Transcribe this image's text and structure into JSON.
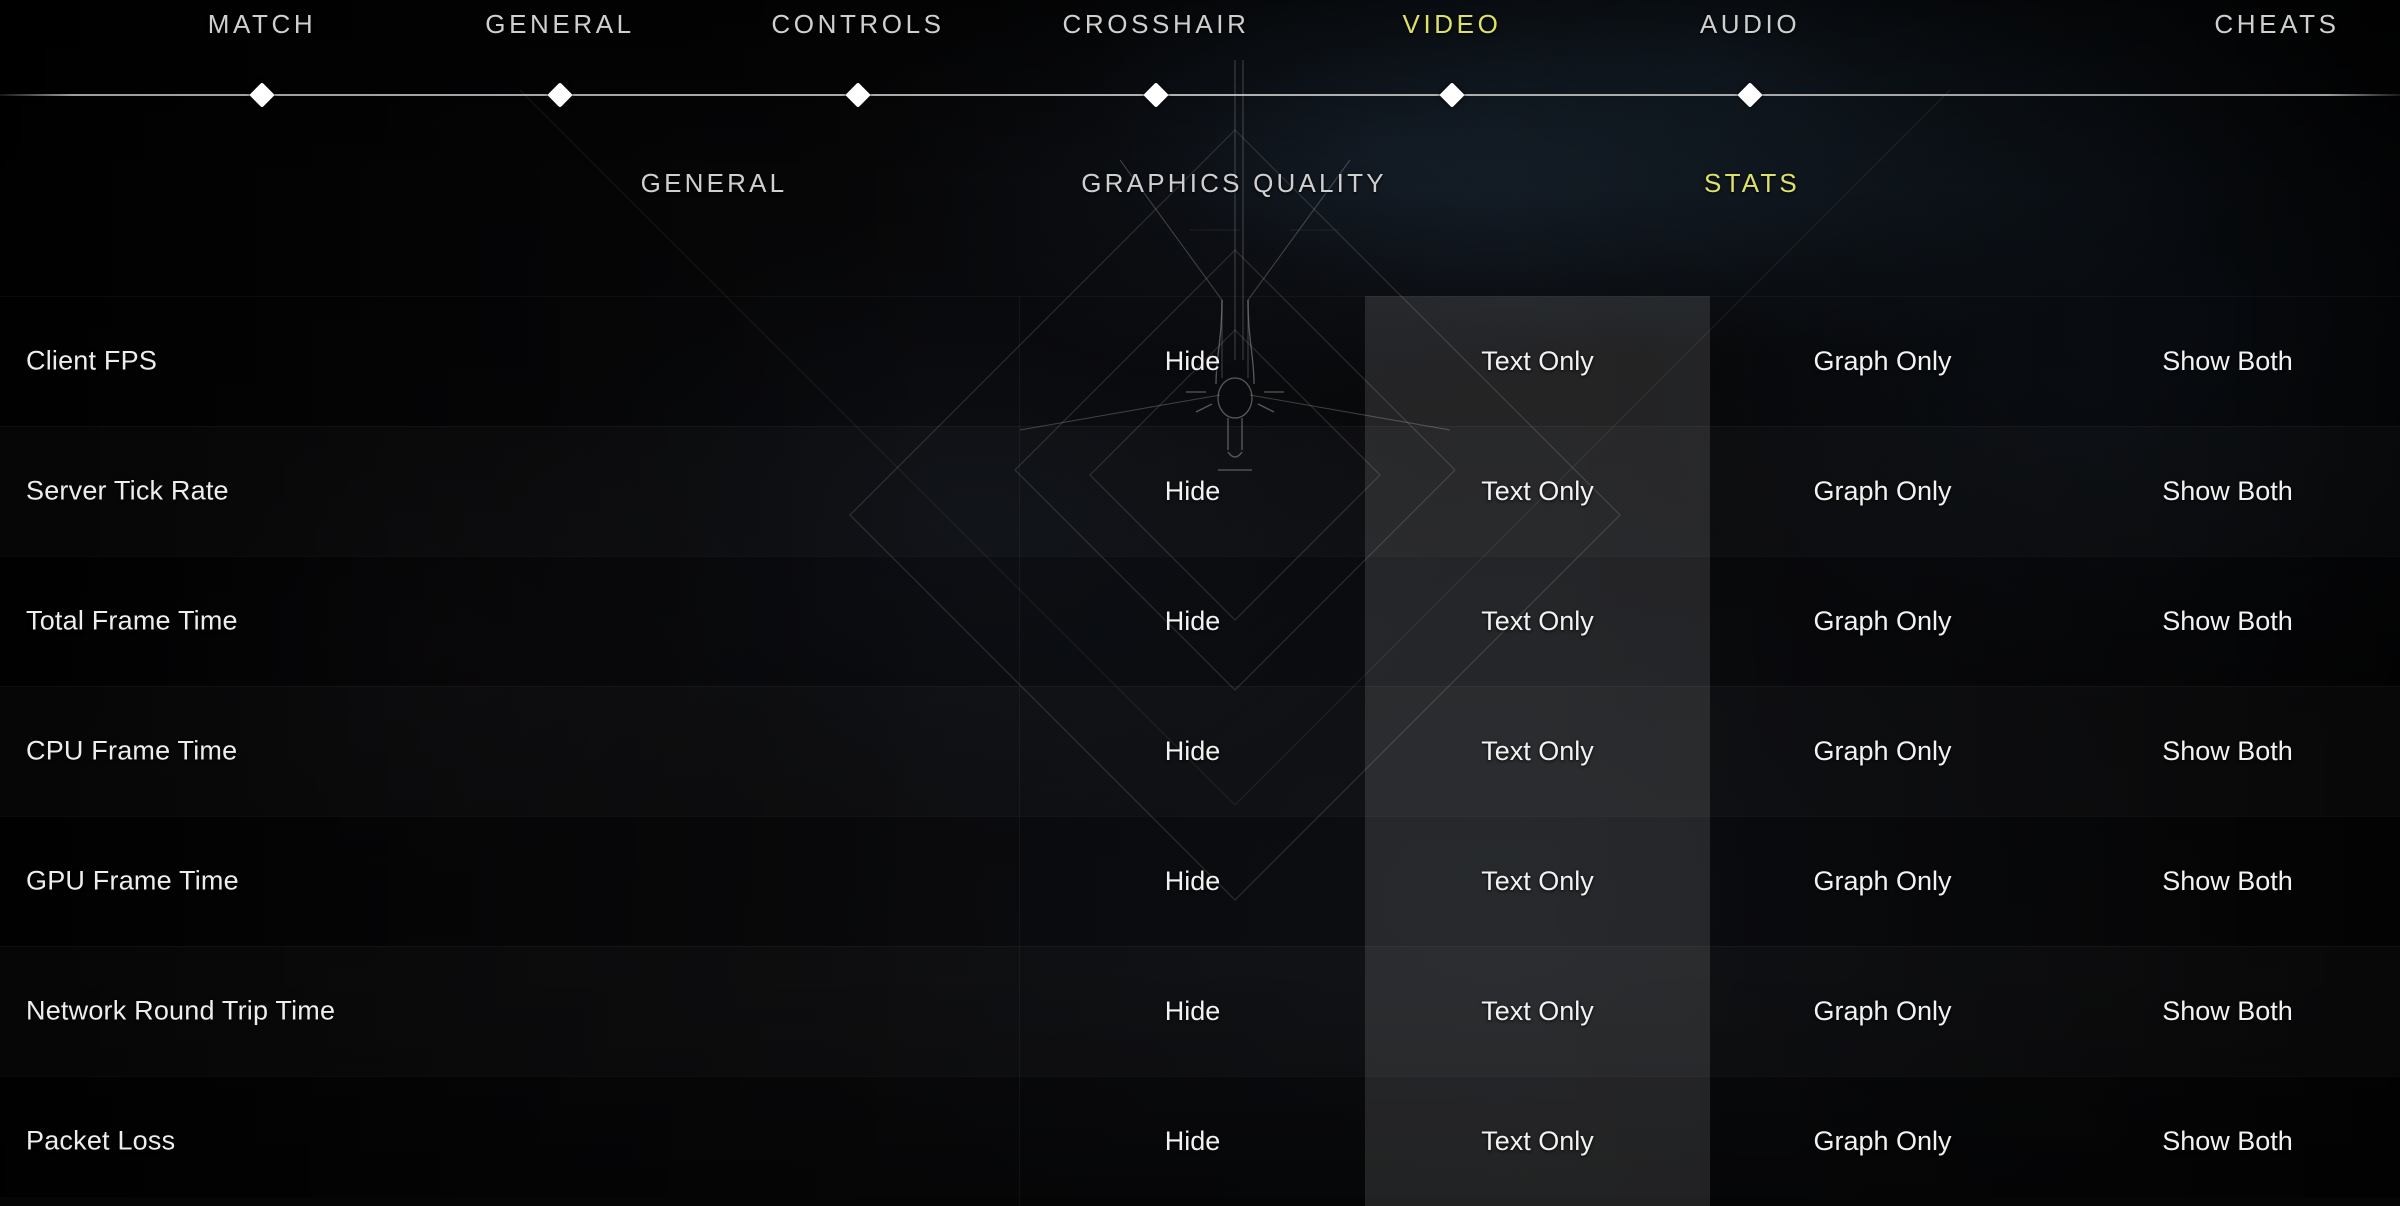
{
  "colors": {
    "accent_yellow": "#dee06c",
    "text_primary": "#ededed",
    "text_nav": "#cfcfcf",
    "row_highlight": "rgba(255,255,255,0.115)",
    "background": "#060607"
  },
  "topnav": {
    "items": [
      {
        "label": "MATCH",
        "active": false,
        "marker": true
      },
      {
        "label": "GENERAL",
        "active": false,
        "marker": true
      },
      {
        "label": "CONTROLS",
        "active": false,
        "marker": true
      },
      {
        "label": "CROSSHAIR",
        "active": false,
        "marker": true
      },
      {
        "label": "VIDEO",
        "active": true,
        "marker": true
      },
      {
        "label": "AUDIO",
        "active": false,
        "marker": true
      },
      {
        "label": "CHEATS",
        "active": false,
        "marker": false
      }
    ]
  },
  "subnav": {
    "items": [
      {
        "label": "GENERAL",
        "active": false
      },
      {
        "label": "GRAPHICS QUALITY",
        "active": false
      },
      {
        "label": "STATS",
        "active": true
      }
    ]
  },
  "settings": {
    "options": [
      "Hide",
      "Text Only",
      "Graph Only",
      "Show Both"
    ],
    "selected_option_index": 1,
    "rows": [
      {
        "label": "Client FPS",
        "selected": "Text Only"
      },
      {
        "label": "Server Tick Rate",
        "selected": "Text Only"
      },
      {
        "label": "Total Frame Time",
        "selected": "Text Only"
      },
      {
        "label": "CPU Frame Time",
        "selected": "Text Only"
      },
      {
        "label": "GPU Frame Time",
        "selected": "Text Only"
      },
      {
        "label": "Network Round Trip Time",
        "selected": "Text Only"
      },
      {
        "label": "Packet Loss",
        "selected": "Text Only"
      }
    ]
  }
}
